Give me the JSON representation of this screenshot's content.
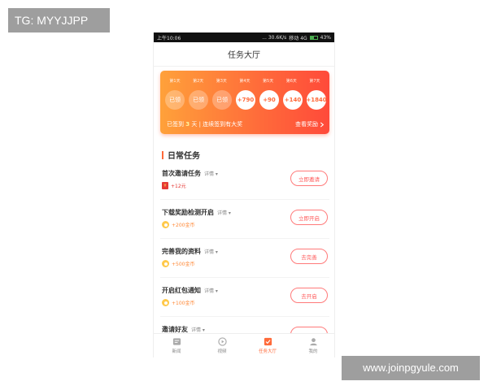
{
  "watermark_top": "TG: MYYJJPP",
  "watermark_bottom": "www.joinpgyule.com",
  "statusbar": {
    "time": "上午10:06",
    "network": "... 30.6K/s",
    "carrier": "移动 4G",
    "battery": "43%"
  },
  "header": {
    "title": "任务大厅"
  },
  "checkin": {
    "days": [
      "第1天",
      "第2天",
      "第3天",
      "第4天",
      "第5天",
      "第6天",
      "第7天"
    ],
    "coins": [
      {
        "label": "已领",
        "done": true
      },
      {
        "label": "已领",
        "done": true
      },
      {
        "label": "已领",
        "done": true
      },
      {
        "label": "+790",
        "done": false
      },
      {
        "label": "+90",
        "done": false
      },
      {
        "label": "+140",
        "done": false
      },
      {
        "label": "+1840",
        "done": false
      }
    ],
    "signed_prefix": "已签到",
    "signed_days": "3",
    "signed_suffix": "天",
    "bonus_text": "连续签到有大奖",
    "view_reward": "查看奖励"
  },
  "daily": {
    "title": "日常任务",
    "tasks": [
      {
        "name": "首次邀请任务",
        "detail": "详情",
        "reward": "+12元",
        "reward_type": "cash",
        "button": "立即邀请"
      },
      {
        "name": "下载奖励检测开启",
        "detail": "详情",
        "reward": "+200金币",
        "reward_type": "gold",
        "button": "立即开启"
      },
      {
        "name": "完善我的资料",
        "detail": "详情",
        "reward": "+500金币",
        "reward_type": "gold",
        "button": "去完善"
      },
      {
        "name": "开启红包通知",
        "detail": "详情",
        "reward": "+100金币",
        "reward_type": "gold",
        "button": "去开启"
      },
      {
        "name": "邀请好友",
        "detail": "详情",
        "reward": "",
        "reward_type": "gold",
        "button": ""
      }
    ]
  },
  "tabbar": {
    "items": [
      {
        "label": "新闻",
        "icon": "news-icon"
      },
      {
        "label": "视频",
        "icon": "video-play-icon"
      },
      {
        "label": "任务大厅",
        "icon": "task-checkbox-icon"
      },
      {
        "label": "我的",
        "icon": "user-profile-icon"
      }
    ],
    "active_index": 2
  },
  "colors": {
    "accent": "#ff6a3a",
    "gradient_start": "#ffa13a",
    "gradient_end": "#ff4a3a",
    "button_border": "#ff7a7a"
  }
}
